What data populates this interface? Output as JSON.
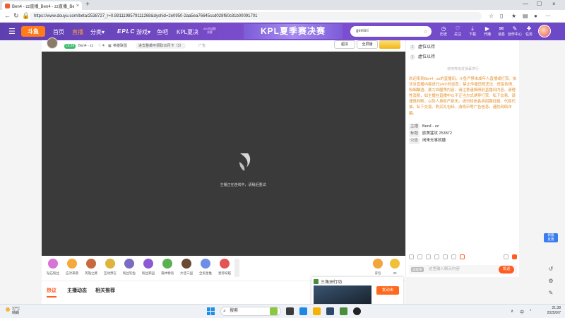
{
  "browser": {
    "tab_title": "Ben4 - zz直播_Ben4 - zz直播_Ben",
    "url": "https://www.douyu.com/beta/2538727_r=0.8911198579111268&dyshid=2e0950-2aa5ea76645ccd028f60c81b00091701",
    "new_tab": "+",
    "close": "×",
    "minimize": "—",
    "maximize": "☐"
  },
  "header": {
    "logo": "斗鱼",
    "nav": [
      "首页",
      "直播",
      "分类▾",
      "游戏▾",
      "鱼吧",
      "KPL夏决"
    ],
    "nav_active_index": 1,
    "brand": "EPLC",
    "ad_badge_line1": "AG对战狼",
    "ad_badge_line2": "决赛",
    "banner": "KPL夏季赛决赛",
    "search_value": "gemini",
    "icons": [
      {
        "glyph": "◷",
        "label": "历史"
      },
      {
        "glyph": "♡",
        "label": "关注"
      },
      {
        "glyph": "⤓",
        "label": "下载"
      },
      {
        "glyph": "▶",
        "label": "开播"
      },
      {
        "glyph": "✉",
        "label": "消息"
      },
      {
        "glyph": "✎",
        "label": "创作中心"
      },
      {
        "glyph": "✚",
        "label": "任务"
      }
    ]
  },
  "room": {
    "level_badge": "LV.26",
    "anchor": "Ben4 - zz",
    "likes": "4",
    "category": "英雄联盟",
    "notice_pill": "进去整袭可领取10月卡（3）",
    "ad_label": "广告",
    "btn_quality": "超清",
    "btn_fullscreen": "全屏播",
    "player_message": "主播正在连线中，请稍后重试"
  },
  "gifts": [
    {
      "label": "钻石粉丝",
      "color": "#d774d6"
    },
    {
      "label": "应对来袭",
      "color": "#f6a93b"
    },
    {
      "label": "英雄之路",
      "color": "#c76b3e"
    },
    {
      "label": "互动预言",
      "color": "#e0b43a"
    },
    {
      "label": "粉丝钓鱼",
      "color": "#7b6cc2"
    },
    {
      "label": "粉丝家园",
      "color": "#8e5ad3"
    },
    {
      "label": "森林物语",
      "color": "#5bb04f"
    },
    {
      "label": "大话三国",
      "color": "#6b4a33"
    },
    {
      "label": "全民星推",
      "color": "#6f8fe6"
    },
    {
      "label": "星际穿越",
      "color": "#e35555"
    }
  ],
  "giftbar_right": [
    {
      "label": "背包",
      "color": "#f1a53a"
    },
    {
      "label": "33",
      "color": "#f0c03a"
    }
  ],
  "page_tabs": [
    "热议",
    "主播动态",
    "相关推荐"
  ],
  "sidebar": {
    "rank": [
      {
        "num": "2",
        "name": "虚位以待"
      },
      {
        "num": "3",
        "name": "虚位以待"
      }
    ],
    "rank_link": "使用等级发弹幕排行",
    "notice": "欢迎来到Ben4 - zz的直播间。斗鱼严禁未成年人直播或打赏。依法对直播内容进行24小时巡查，禁止传播违规违法、低俗色情、吸烟酗酒、暴力血腥等内容，请注意谨慎辨别直播间内容。请理性消费，如主播在直播中以不正当方式诱导打赏、私下交易，请谨慎判断，以防人身财产损失。请勿轻信各类招聘征婚、代练代抽、私下交易、购买礼包码、游戏币等广告信息，谨防网络诈骗。",
    "info": [
      {
        "key": "主播",
        "value": "Ben4 - zz"
      },
      {
        "key": "标题",
        "value": "欧美猛攻 253872"
      },
      {
        "key": "公告",
        "value": "闲来无事就播"
      }
    ],
    "chat_badge": "高级弹",
    "chat_placeholder": "这里输入聊天内容",
    "send": "发送"
  },
  "float": {
    "new_label_1": "新版",
    "new_label_2": "反馈",
    "icons": [
      "↺",
      "⚙",
      "✎"
    ]
  },
  "popup": {
    "title": "三角洲行动",
    "button": "发动击"
  },
  "taskbar": {
    "weather_temp": "37°C",
    "weather_desc": "晴朗",
    "search": "搜索",
    "tray_up": "∧",
    "tray_lang": "中",
    "time": "21:38",
    "date": "2025/9/7"
  }
}
